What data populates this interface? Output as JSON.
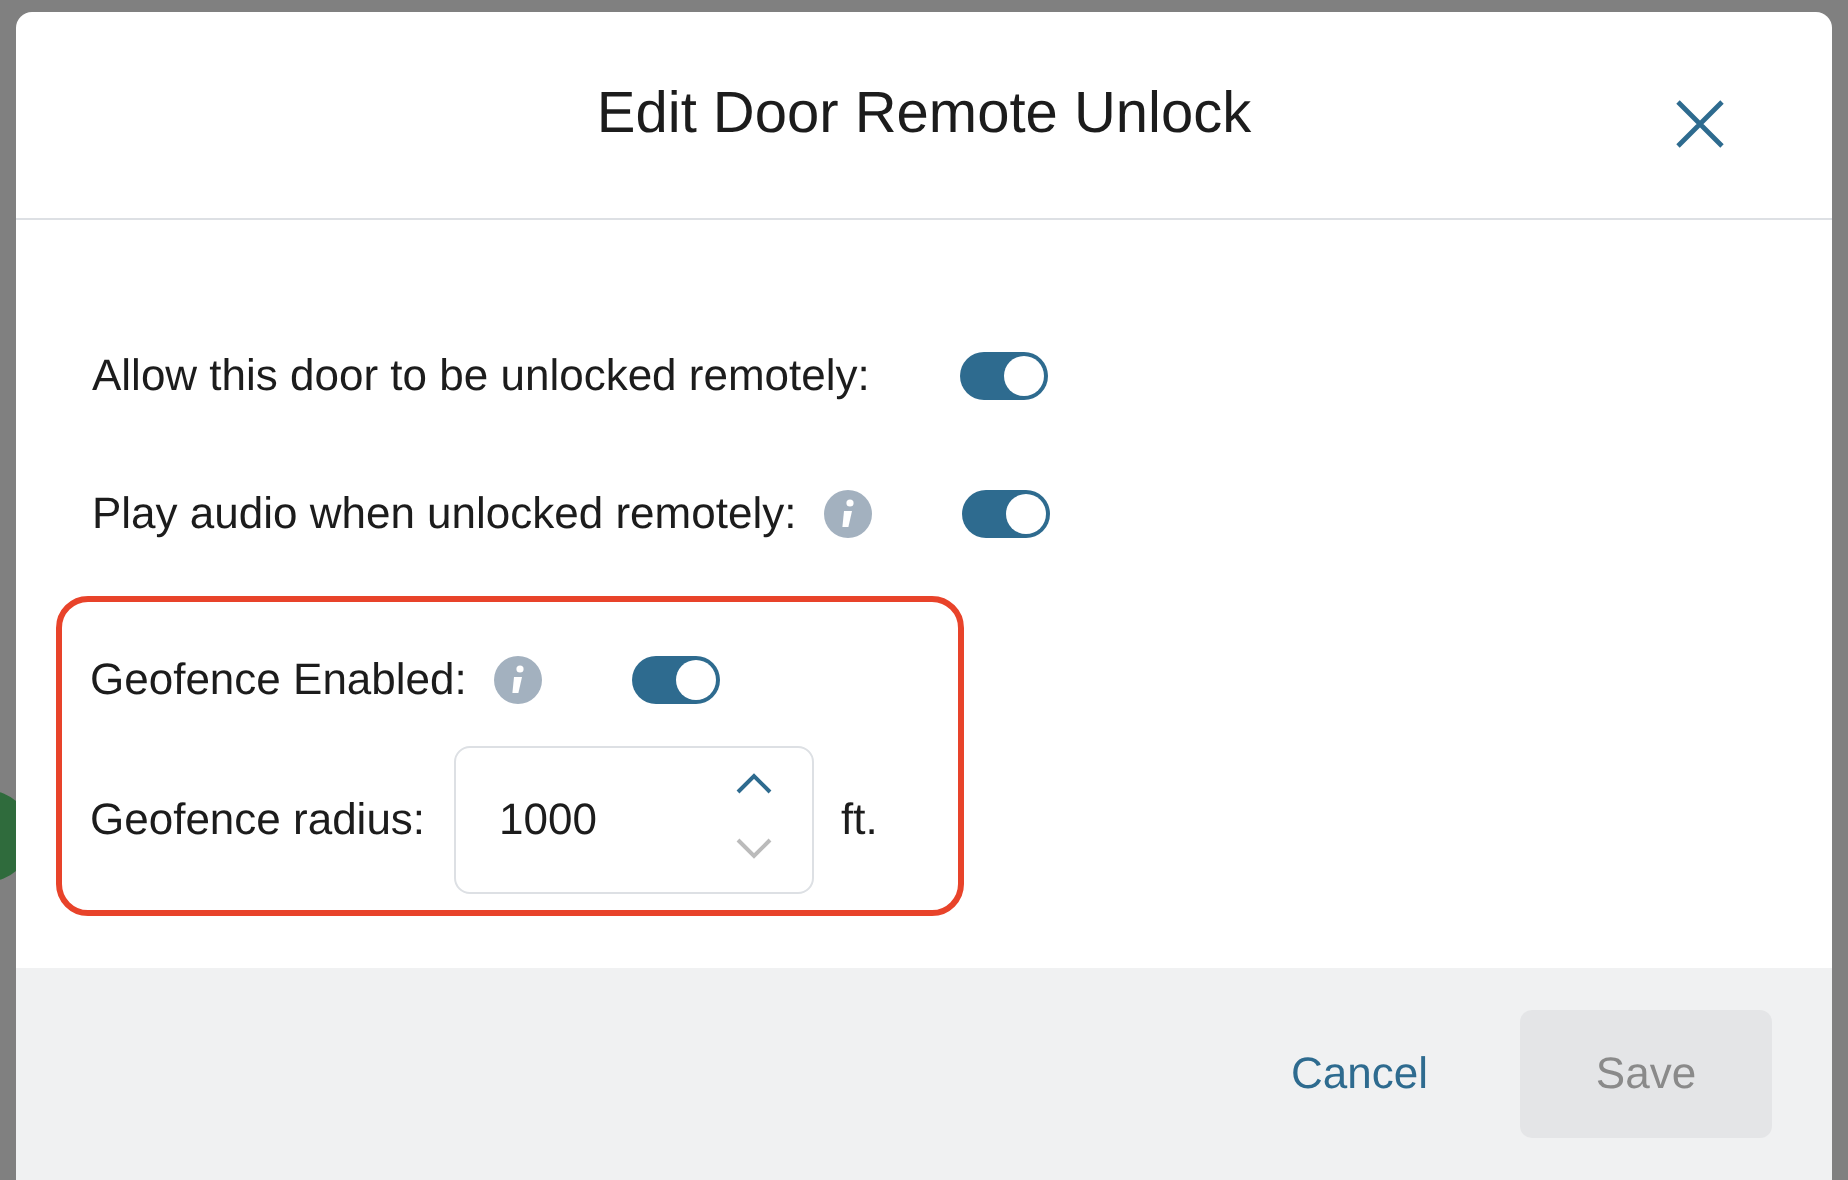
{
  "dialog": {
    "title": "Edit Door Remote Unlock"
  },
  "settings": [
    {
      "kind": "toggle",
      "label": "Allow this door to be unlocked remotely:",
      "info": false,
      "on": true,
      "highlighted": false
    },
    {
      "kind": "toggle",
      "label": "Play audio when unlocked remotely:",
      "info": true,
      "on": true,
      "highlighted": false
    },
    {
      "kind": "toggle",
      "label": "Geofence Enabled:",
      "info": true,
      "on": true,
      "highlighted": true
    },
    {
      "kind": "number",
      "label": "Geofence radius:",
      "value": "1000",
      "unit": "ft.",
      "highlighted": true
    }
  ],
  "buttons": [
    {
      "kind": "link",
      "label": "Cancel",
      "disabled": false
    },
    {
      "kind": "primary",
      "label": "Save",
      "disabled": true
    }
  ]
}
